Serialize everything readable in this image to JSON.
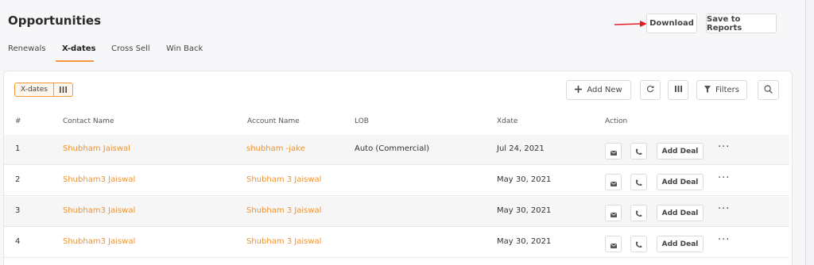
{
  "header": {
    "title": "Opportunities",
    "download_label": "Download",
    "save_label": "Save to Reports"
  },
  "tabs": [
    {
      "label": "Renewals"
    },
    {
      "label": "X-dates",
      "active": true
    },
    {
      "label": "Cross Sell"
    },
    {
      "label": "Win Back"
    }
  ],
  "toolbar": {
    "chip_label": "X-dates",
    "add_label": "Add New",
    "filters_label": "Filters"
  },
  "table": {
    "columns": [
      "#",
      "Contact Name",
      "Account Name",
      "LOB",
      "Xdate",
      "Action"
    ],
    "add_deal_label": "Add Deal",
    "more_label": "···",
    "rows": [
      {
        "num": "1",
        "contact": "Shubham Jaiswal",
        "account": "shubham -jake",
        "lob": "Auto (Commercial)",
        "xdate": "Jul 24, 2021"
      },
      {
        "num": "2",
        "contact": "Shubham3 Jaiswal",
        "account": "Shubham 3 Jaiswal",
        "lob": "",
        "xdate": "May 30, 2021"
      },
      {
        "num": "3",
        "contact": "Shubham3 Jaiswal",
        "account": "Shubham 3 Jaiswal",
        "lob": "",
        "xdate": "May 30, 2021"
      },
      {
        "num": "4",
        "contact": "Shubham3 Jaiswal",
        "account": "Shubham 3 Jaiswal",
        "lob": "",
        "xdate": "May 30, 2021"
      }
    ]
  },
  "colors": {
    "accent": "#f29a3b",
    "link": "#f0922e",
    "arrow": "#e02020"
  },
  "icons": [
    "red-arrow-icon",
    "columns-icon",
    "plus-icon",
    "refresh-icon",
    "grid-icon",
    "filter-icon",
    "search-icon",
    "email-icon",
    "phone-icon"
  ]
}
